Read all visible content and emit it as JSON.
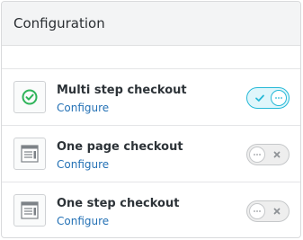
{
  "panel": {
    "title": "Configuration"
  },
  "options": [
    {
      "title": "Multi step checkout",
      "link_label": "Configure",
      "enabled": true,
      "icon": "multi-step-checkout-icon"
    },
    {
      "title": "One page checkout",
      "link_label": "Configure",
      "enabled": false,
      "icon": "one-page-checkout-icon"
    },
    {
      "title": "One step checkout",
      "link_label": "Configure",
      "enabled": false,
      "icon": "one-step-checkout-icon"
    }
  ],
  "colors": {
    "accent": "#25b9d7",
    "success": "#2fb45a",
    "link": "#2471b5"
  }
}
